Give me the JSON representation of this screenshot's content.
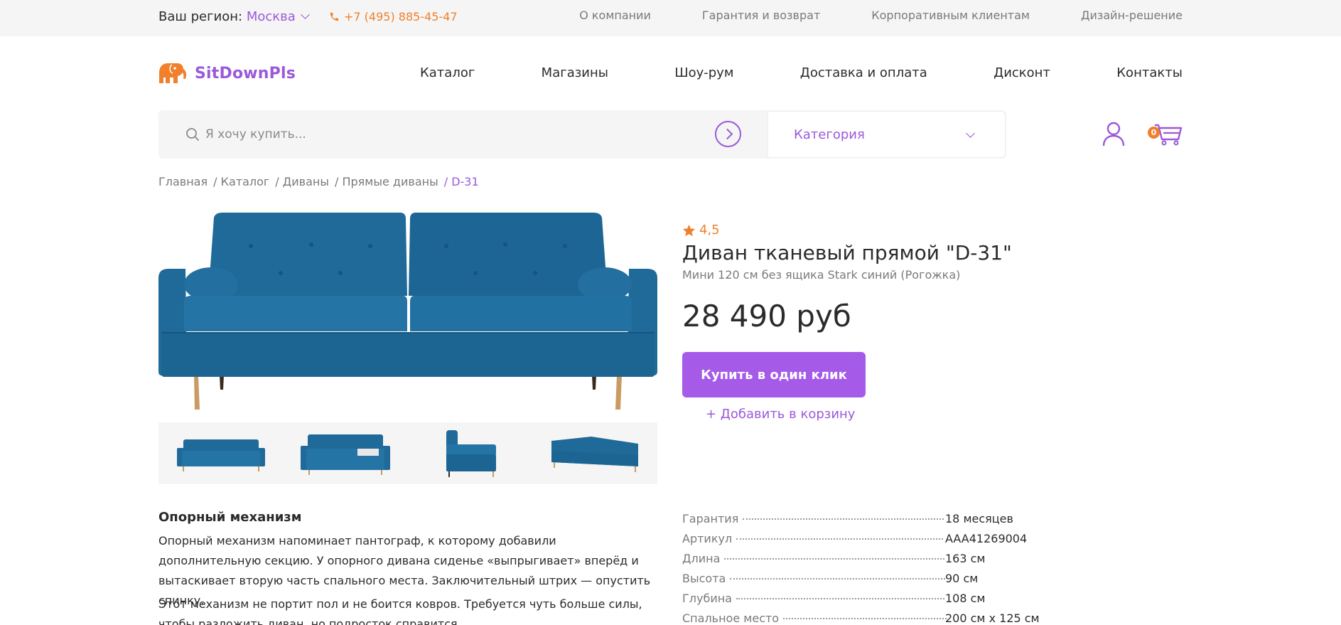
{
  "topbar": {
    "region_label": "Ваш регион:",
    "region_city": "Москва",
    "phone": "+7 (495) 885-45-47",
    "links": [
      "О компании",
      "Гарантия и возврат",
      "Корпоративным клиентам",
      "Дизайн-решение"
    ]
  },
  "header": {
    "logo_text": "SitDownPls",
    "nav": [
      "Каталог",
      "Магазины",
      "Шоу-рум",
      "Доставка и оплата",
      "Дисконт",
      "Контакты"
    ]
  },
  "search": {
    "placeholder": "Я хочу купить...",
    "value": "",
    "category_label": "Категория"
  },
  "cart": {
    "count": "0"
  },
  "breadcrumb": [
    "Главная",
    "/ Каталог",
    "/ Диваны",
    "/ Прямые диваны",
    "/ D-31"
  ],
  "product": {
    "rating": "4,5",
    "title": "Диван тканевый прямой \"D-31\"",
    "subtitle": "Мини 120 см без ящика Stark синий (Рогожка)",
    "price": "28 490 руб",
    "buy_label": "Купить в один клик",
    "add_to_cart_label": "+ Добавить в корзину"
  },
  "description": {
    "title": "Опорный механизм",
    "p1": "Опорный механизм напоминает пантограф, к которому добавили дополнительную секцию. У опорного дивана сиденье «выпрыгивает» вперёд и вытаскивает вторую часть спального места. Заключительный штрих — опустить спинку.",
    "p2": "Этот механизм не портит пол и не боится ковров. Требуется чуть больше силы, чтобы разложить диван, но подросток справится."
  },
  "specs": [
    {
      "key": "Гарантия",
      "value": "18 месяцев"
    },
    {
      "key": "Артикул",
      "value": "AAA41269004"
    },
    {
      "key": "Длина",
      "value": "163 см"
    },
    {
      "key": "Высота",
      "value": "90 см"
    },
    {
      "key": "Глубина",
      "value": "108 см"
    },
    {
      "key": "Спальное место",
      "value": "200 см х 125 см"
    }
  ],
  "colors": {
    "accent": "#9b59d9",
    "button": "#a65ae8",
    "orange": "#f0802c",
    "sofa": "#1f6a99"
  }
}
